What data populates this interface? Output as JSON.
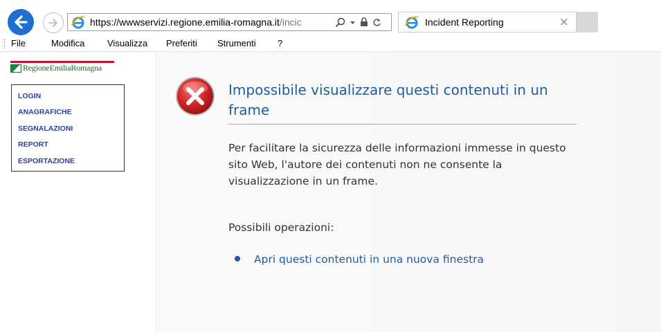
{
  "browser": {
    "url_prefix": "https://www",
    "url_host": "servizi.regione.emilia-romagna.it",
    "url_path": "/incic",
    "tab_title": "Incident Reporting",
    "tab_close": "×"
  },
  "menu": {
    "items": [
      "File",
      "Modifica",
      "Visualizza",
      "Preferiti",
      "Strumenti",
      "?"
    ]
  },
  "sidebar": {
    "logo_text": "RegioneEmiliaRomagna",
    "links": [
      "LOGIN",
      "ANAGRAFICHE",
      "SEGNALAZIONI",
      "REPORT",
      "ESPORTAZIONE"
    ]
  },
  "error": {
    "title": "Impossibile visualizzare questi contenuti in un frame",
    "body": "Per facilitare la sicurezza delle informazioni immesse in questo sito Web, l'autore dei contenuti non ne consente la visualizzazione in un frame.",
    "operations_label": "Possibili operazioni:",
    "open_link": "Apri questi contenuti in una nuova finestra"
  },
  "colors": {
    "back_button": "#1e6fd0",
    "error_blue": "#1f5c99",
    "nav_link": "#2a3f9e",
    "error_red": "#c81e1e"
  },
  "icons": [
    "back-arrow-icon",
    "forward-arrow-icon",
    "ie-logo-icon",
    "search-icon",
    "dropdown-icon",
    "lock-icon",
    "refresh-icon",
    "close-icon",
    "error-icon",
    "bullet-icon"
  ]
}
